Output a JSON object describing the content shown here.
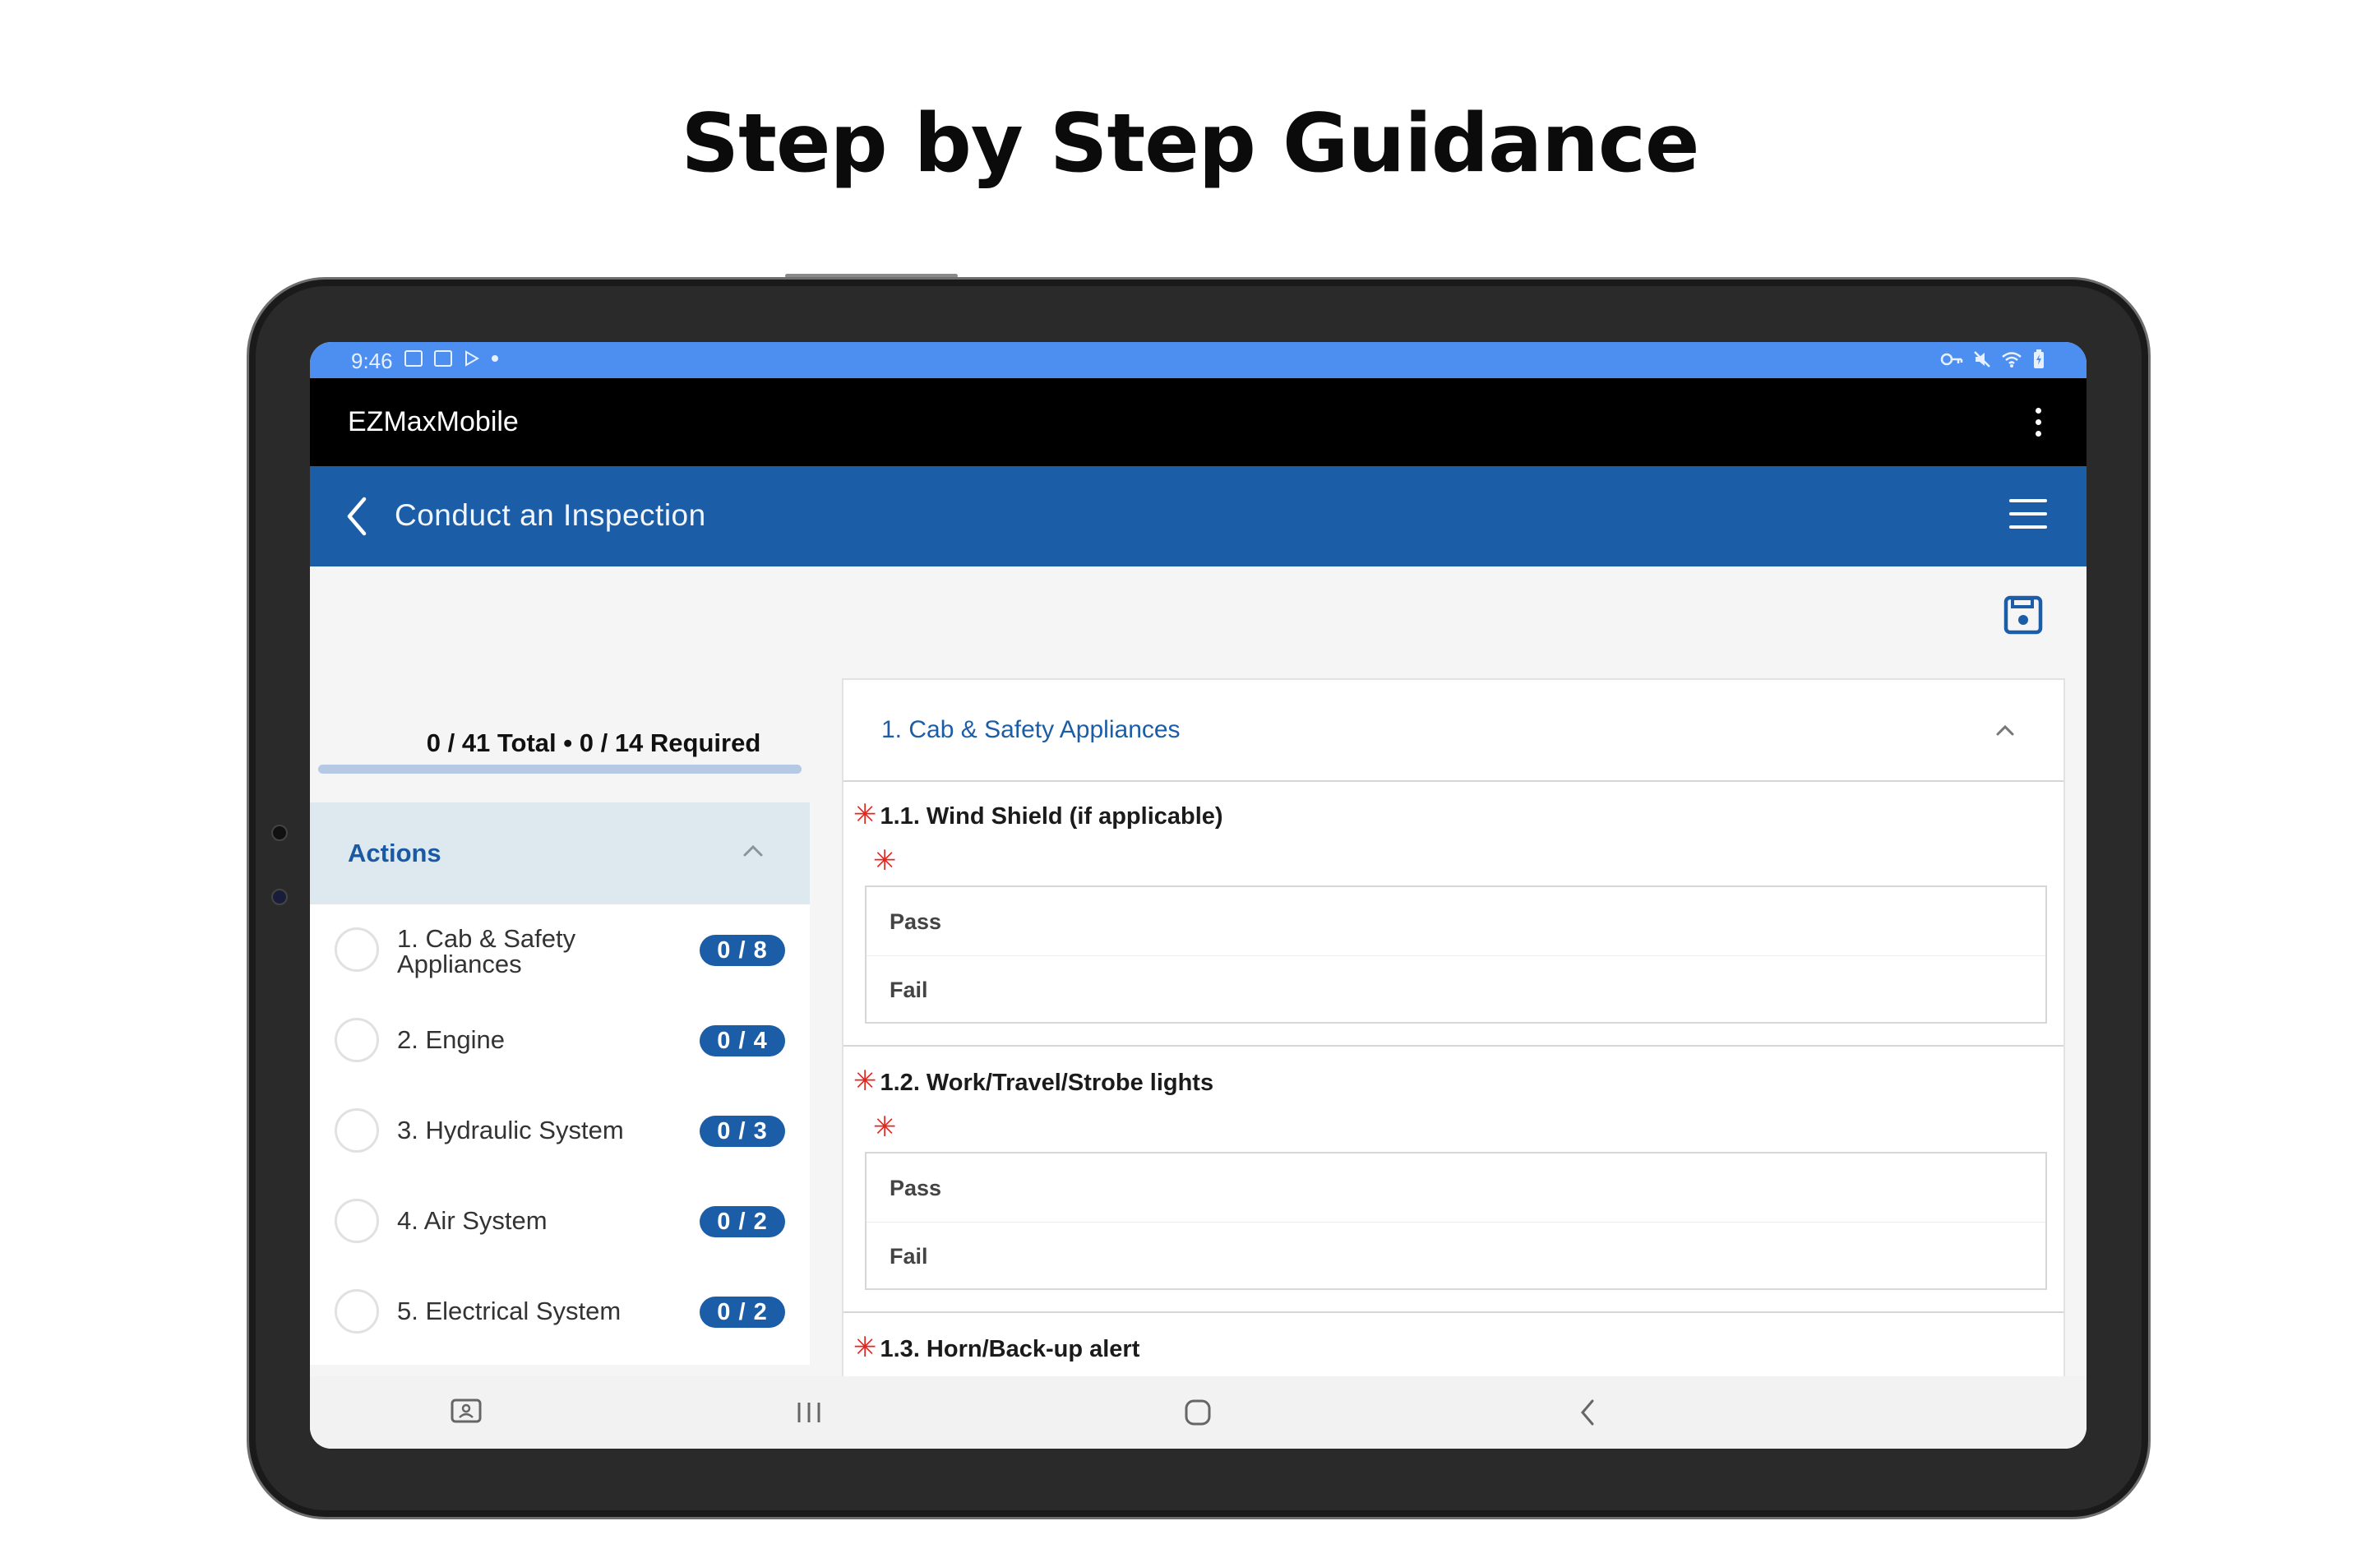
{
  "headline": "Step by Step Guidance",
  "status_bar": {
    "time": "9:46"
  },
  "app_bar": {
    "title": "EZMaxMobile"
  },
  "nav_bar": {
    "title": "Conduct an Inspection"
  },
  "progress": {
    "text": "0 / 41 Total • 0 / 14 Required",
    "completed_fraction": 0.0
  },
  "actions": {
    "header": "Actions",
    "items": [
      {
        "line1": "1. Cab & Safety",
        "line2": "Appliances",
        "badge": "0 / 8"
      },
      {
        "line1": "2. Engine",
        "line2": "",
        "badge": "0 / 4"
      },
      {
        "line1": "3. Hydraulic System",
        "line2": "",
        "badge": "0 / 3"
      },
      {
        "line1": "4. Air System",
        "line2": "",
        "badge": "0 / 2"
      },
      {
        "line1": "5. Electrical System",
        "line2": "",
        "badge": "0 / 2"
      }
    ]
  },
  "section": {
    "title": "1. Cab & Safety Appliances",
    "questions": [
      {
        "title": "1.1. Wind Shield (if applicable)",
        "options": [
          "Pass",
          "Fail"
        ]
      },
      {
        "title": "1.2. Work/Travel/Strobe lights",
        "options": [
          "Pass",
          "Fail"
        ]
      },
      {
        "title": "1.3. Horn/Back-up alert",
        "options": []
      }
    ],
    "required_marker": "✳"
  },
  "colors": {
    "status_bar": "#4c8ff0",
    "app_bar": "#000000",
    "nav_bar": "#1c5da8",
    "accent": "#1c5da8",
    "required": "#e3261f",
    "actions_header_bg": "#dde9ee"
  },
  "icons": {
    "back": "chevron-left-icon",
    "menu": "hamburger-icon",
    "overflow": "kebab-icon",
    "save": "floppy-disk-icon",
    "collapse": "chevron-up-icon"
  }
}
